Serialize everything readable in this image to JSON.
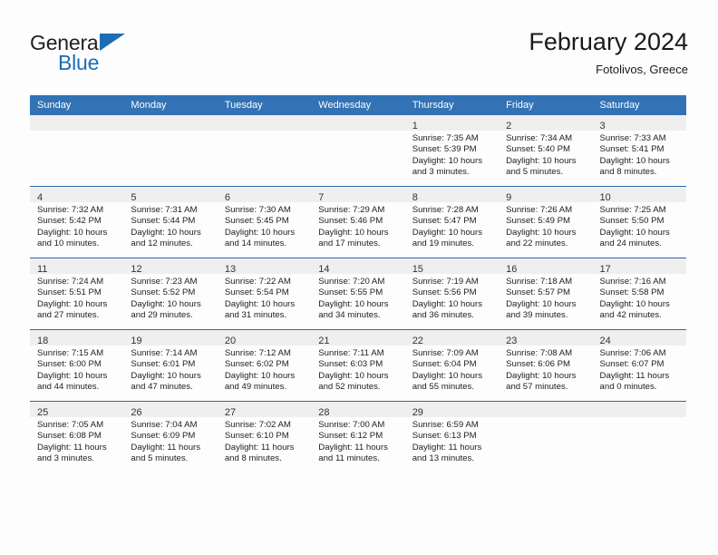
{
  "brand": {
    "name_top": "General",
    "name_bottom": "Blue",
    "triangle_color": "#1d6cb5"
  },
  "header": {
    "title": "February 2024",
    "location": "Fotolivos, Greece"
  },
  "theme": {
    "header_bg": "#3272b5",
    "row_rule": "#2a6aac",
    "daynum_band": "#efefef",
    "page_bg": "#fdfdfd"
  },
  "weekday_headers": [
    "Sunday",
    "Monday",
    "Tuesday",
    "Wednesday",
    "Thursday",
    "Friday",
    "Saturday"
  ],
  "labels": {
    "sunrise_prefix": "Sunrise:",
    "sunset_prefix": "Sunset:",
    "daylight_prefix": "Daylight:"
  },
  "weeks": [
    [
      {
        "day": "",
        "sunrise": "",
        "sunset": "",
        "daylight_line1": "",
        "daylight_line2": "",
        "empty": true
      },
      {
        "day": "",
        "sunrise": "",
        "sunset": "",
        "daylight_line1": "",
        "daylight_line2": "",
        "empty": true
      },
      {
        "day": "",
        "sunrise": "",
        "sunset": "",
        "daylight_line1": "",
        "daylight_line2": "",
        "empty": true
      },
      {
        "day": "",
        "sunrise": "",
        "sunset": "",
        "daylight_line1": "",
        "daylight_line2": "",
        "empty": true
      },
      {
        "day": "1",
        "sunrise": "Sunrise: 7:35 AM",
        "sunset": "Sunset: 5:39 PM",
        "daylight_line1": "Daylight: 10 hours",
        "daylight_line2": "and 3 minutes.",
        "empty": false
      },
      {
        "day": "2",
        "sunrise": "Sunrise: 7:34 AM",
        "sunset": "Sunset: 5:40 PM",
        "daylight_line1": "Daylight: 10 hours",
        "daylight_line2": "and 5 minutes.",
        "empty": false
      },
      {
        "day": "3",
        "sunrise": "Sunrise: 7:33 AM",
        "sunset": "Sunset: 5:41 PM",
        "daylight_line1": "Daylight: 10 hours",
        "daylight_line2": "and 8 minutes.",
        "empty": false
      }
    ],
    [
      {
        "day": "4",
        "sunrise": "Sunrise: 7:32 AM",
        "sunset": "Sunset: 5:42 PM",
        "daylight_line1": "Daylight: 10 hours",
        "daylight_line2": "and 10 minutes.",
        "empty": false
      },
      {
        "day": "5",
        "sunrise": "Sunrise: 7:31 AM",
        "sunset": "Sunset: 5:44 PM",
        "daylight_line1": "Daylight: 10 hours",
        "daylight_line2": "and 12 minutes.",
        "empty": false
      },
      {
        "day": "6",
        "sunrise": "Sunrise: 7:30 AM",
        "sunset": "Sunset: 5:45 PM",
        "daylight_line1": "Daylight: 10 hours",
        "daylight_line2": "and 14 minutes.",
        "empty": false
      },
      {
        "day": "7",
        "sunrise": "Sunrise: 7:29 AM",
        "sunset": "Sunset: 5:46 PM",
        "daylight_line1": "Daylight: 10 hours",
        "daylight_line2": "and 17 minutes.",
        "empty": false
      },
      {
        "day": "8",
        "sunrise": "Sunrise: 7:28 AM",
        "sunset": "Sunset: 5:47 PM",
        "daylight_line1": "Daylight: 10 hours",
        "daylight_line2": "and 19 minutes.",
        "empty": false
      },
      {
        "day": "9",
        "sunrise": "Sunrise: 7:26 AM",
        "sunset": "Sunset: 5:49 PM",
        "daylight_line1": "Daylight: 10 hours",
        "daylight_line2": "and 22 minutes.",
        "empty": false
      },
      {
        "day": "10",
        "sunrise": "Sunrise: 7:25 AM",
        "sunset": "Sunset: 5:50 PM",
        "daylight_line1": "Daylight: 10 hours",
        "daylight_line2": "and 24 minutes.",
        "empty": false
      }
    ],
    [
      {
        "day": "11",
        "sunrise": "Sunrise: 7:24 AM",
        "sunset": "Sunset: 5:51 PM",
        "daylight_line1": "Daylight: 10 hours",
        "daylight_line2": "and 27 minutes.",
        "empty": false
      },
      {
        "day": "12",
        "sunrise": "Sunrise: 7:23 AM",
        "sunset": "Sunset: 5:52 PM",
        "daylight_line1": "Daylight: 10 hours",
        "daylight_line2": "and 29 minutes.",
        "empty": false
      },
      {
        "day": "13",
        "sunrise": "Sunrise: 7:22 AM",
        "sunset": "Sunset: 5:54 PM",
        "daylight_line1": "Daylight: 10 hours",
        "daylight_line2": "and 31 minutes.",
        "empty": false
      },
      {
        "day": "14",
        "sunrise": "Sunrise: 7:20 AM",
        "sunset": "Sunset: 5:55 PM",
        "daylight_line1": "Daylight: 10 hours",
        "daylight_line2": "and 34 minutes.",
        "empty": false
      },
      {
        "day": "15",
        "sunrise": "Sunrise: 7:19 AM",
        "sunset": "Sunset: 5:56 PM",
        "daylight_line1": "Daylight: 10 hours",
        "daylight_line2": "and 36 minutes.",
        "empty": false
      },
      {
        "day": "16",
        "sunrise": "Sunrise: 7:18 AM",
        "sunset": "Sunset: 5:57 PM",
        "daylight_line1": "Daylight: 10 hours",
        "daylight_line2": "and 39 minutes.",
        "empty": false
      },
      {
        "day": "17",
        "sunrise": "Sunrise: 7:16 AM",
        "sunset": "Sunset: 5:58 PM",
        "daylight_line1": "Daylight: 10 hours",
        "daylight_line2": "and 42 minutes.",
        "empty": false
      }
    ],
    [
      {
        "day": "18",
        "sunrise": "Sunrise: 7:15 AM",
        "sunset": "Sunset: 6:00 PM",
        "daylight_line1": "Daylight: 10 hours",
        "daylight_line2": "and 44 minutes.",
        "empty": false
      },
      {
        "day": "19",
        "sunrise": "Sunrise: 7:14 AM",
        "sunset": "Sunset: 6:01 PM",
        "daylight_line1": "Daylight: 10 hours",
        "daylight_line2": "and 47 minutes.",
        "empty": false
      },
      {
        "day": "20",
        "sunrise": "Sunrise: 7:12 AM",
        "sunset": "Sunset: 6:02 PM",
        "daylight_line1": "Daylight: 10 hours",
        "daylight_line2": "and 49 minutes.",
        "empty": false
      },
      {
        "day": "21",
        "sunrise": "Sunrise: 7:11 AM",
        "sunset": "Sunset: 6:03 PM",
        "daylight_line1": "Daylight: 10 hours",
        "daylight_line2": "and 52 minutes.",
        "empty": false
      },
      {
        "day": "22",
        "sunrise": "Sunrise: 7:09 AM",
        "sunset": "Sunset: 6:04 PM",
        "daylight_line1": "Daylight: 10 hours",
        "daylight_line2": "and 55 minutes.",
        "empty": false
      },
      {
        "day": "23",
        "sunrise": "Sunrise: 7:08 AM",
        "sunset": "Sunset: 6:06 PM",
        "daylight_line1": "Daylight: 10 hours",
        "daylight_line2": "and 57 minutes.",
        "empty": false
      },
      {
        "day": "24",
        "sunrise": "Sunrise: 7:06 AM",
        "sunset": "Sunset: 6:07 PM",
        "daylight_line1": "Daylight: 11 hours",
        "daylight_line2": "and 0 minutes.",
        "empty": false
      }
    ],
    [
      {
        "day": "25",
        "sunrise": "Sunrise: 7:05 AM",
        "sunset": "Sunset: 6:08 PM",
        "daylight_line1": "Daylight: 11 hours",
        "daylight_line2": "and 3 minutes.",
        "empty": false
      },
      {
        "day": "26",
        "sunrise": "Sunrise: 7:04 AM",
        "sunset": "Sunset: 6:09 PM",
        "daylight_line1": "Daylight: 11 hours",
        "daylight_line2": "and 5 minutes.",
        "empty": false
      },
      {
        "day": "27",
        "sunrise": "Sunrise: 7:02 AM",
        "sunset": "Sunset: 6:10 PM",
        "daylight_line1": "Daylight: 11 hours",
        "daylight_line2": "and 8 minutes.",
        "empty": false
      },
      {
        "day": "28",
        "sunrise": "Sunrise: 7:00 AM",
        "sunset": "Sunset: 6:12 PM",
        "daylight_line1": "Daylight: 11 hours",
        "daylight_line2": "and 11 minutes.",
        "empty": false
      },
      {
        "day": "29",
        "sunrise": "Sunrise: 6:59 AM",
        "sunset": "Sunset: 6:13 PM",
        "daylight_line1": "Daylight: 11 hours",
        "daylight_line2": "and 13 minutes.",
        "empty": false
      },
      {
        "day": "",
        "sunrise": "",
        "sunset": "",
        "daylight_line1": "",
        "daylight_line2": "",
        "empty": true
      },
      {
        "day": "",
        "sunrise": "",
        "sunset": "",
        "daylight_line1": "",
        "daylight_line2": "",
        "empty": true
      }
    ]
  ]
}
